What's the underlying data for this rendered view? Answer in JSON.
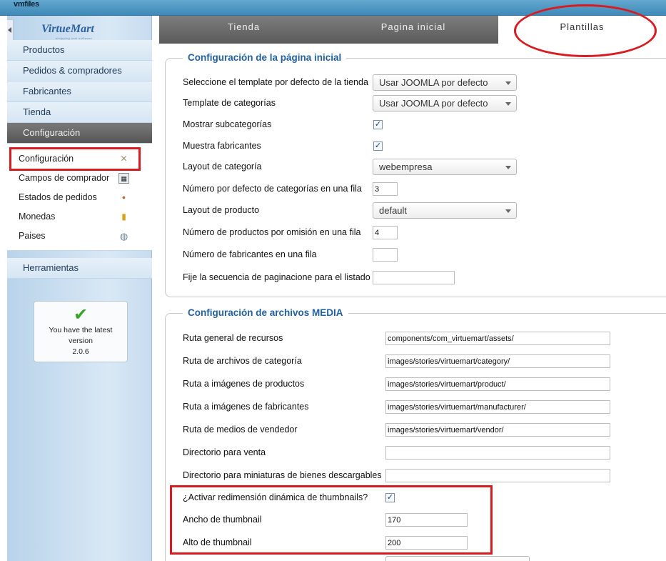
{
  "app": {
    "title": "vmfiles"
  },
  "sidebar": {
    "logo": "VirtueMart",
    "logo_sub": "shopping cart software",
    "menu": {
      "productos": "Productos",
      "pedidos": "Pedidos & compradores",
      "fabricantes": "Fabricantes",
      "tienda": "Tienda",
      "configuracion": "Configuración",
      "herramientas": "Herramientas"
    },
    "submenu": {
      "configuracion": "Configuración",
      "campos": "Campos de comprador",
      "estados": "Estados de pedidos",
      "monedas": "Monedas",
      "paises": "Paises"
    },
    "version": {
      "line1": "You have the latest",
      "line2": "version",
      "line3": "2.0.6"
    }
  },
  "tabs": {
    "tienda": "Tienda",
    "pagina_inicial": "Pagina inicial",
    "plantillas": "Plantillas"
  },
  "home_config": {
    "legend": "Configuración de la página inicial",
    "template_label": "Seleccione el template por defecto de la tienda",
    "template_value": "Usar JOOMLA por defecto",
    "cat_template_label": "Template de categorías",
    "cat_template_value": "Usar JOOMLA por defecto",
    "show_subcats_label": "Mostrar subcategorías",
    "show_subcats_checked": true,
    "show_manuf_label": "Muestra fabricantes",
    "show_manuf_checked": true,
    "cat_layout_label": "Layout de categoría",
    "cat_layout_value": "webempresa",
    "cats_per_row_label": "Número por defecto de categorías en una fila",
    "cats_per_row_value": "3",
    "prod_layout_label": "Layout de producto",
    "prod_layout_value": "default",
    "prods_per_row_label": "Número de productos por omisión en una fila",
    "prods_per_row_value": "4",
    "manuf_per_row_label": "Número de fabricantes en una fila",
    "manuf_per_row_value": "",
    "pagination_label": "Fije la secuencia de paginacione para el listado",
    "pagination_value": ""
  },
  "media_config": {
    "legend": "Configuración de archivos MEDIA",
    "assets_label": "Ruta general de recursos",
    "assets_value": "components/com_virtuemart/assets/",
    "category_label": "Ruta de archivos de categoría",
    "category_value": "images/stories/virtuemart/category/",
    "product_label": "Ruta a imágenes de productos",
    "product_value": "images/stories/virtuemart/product/",
    "manufacturer_label": "Ruta a imágenes de fabricantes",
    "manufacturer_value": "images/stories/virtuemart/manufacturer/",
    "vendor_label": "Ruta de medios de vendedor",
    "vendor_value": "images/stories/virtuemart/vendor/",
    "sale_dir_label": "Directorio para venta",
    "sale_dir_value": "",
    "thumb_dl_label": "Directorio para miniaturas de bienes descargables",
    "thumb_dl_value": "",
    "dynamic_thumb_label": "¿Activar redimensión dinámica de thumbnails?",
    "dynamic_thumb_checked": true,
    "thumb_width_label": "Ancho de thumbnail",
    "thumb_width_value": "170",
    "thumb_height_label": "Alto de thumbnail",
    "thumb_height_value": "200"
  },
  "colors": {
    "accent_legend": "#2260a0",
    "annotation_red": "#d81b21",
    "active_menu": "#5a5a5a"
  },
  "icons": {
    "configuracion": "wrench-screwdriver-icon",
    "campos": "user-fields-icon",
    "estados": "order-status-icon",
    "monedas": "coins-icon",
    "paises": "globe-icon",
    "version": "checkmark-icon"
  }
}
